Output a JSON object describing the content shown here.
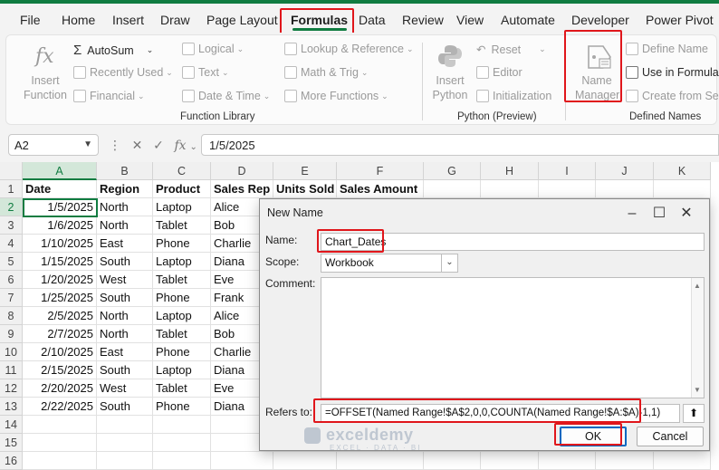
{
  "tabs": [
    "File",
    "Home",
    "Insert",
    "Draw",
    "Page Layout",
    "Formulas",
    "Data",
    "Review",
    "View",
    "Automate",
    "Developer",
    "Power Pivot"
  ],
  "active_tab": "Formulas",
  "ribbon": {
    "insert_function": "Insert Function",
    "autosum": "AutoSum",
    "recently_used": "Recently Used",
    "financial": "Financial",
    "logical": "Logical",
    "text": "Text",
    "date_time": "Date & Time",
    "lookup_reference": "Lookup & Reference",
    "math_trig": "Math & Trig",
    "more_functions": "More Functions",
    "function_library": "Function Library",
    "insert_python": "Insert Python",
    "reset": "Reset",
    "editor": "Editor",
    "initialization": "Initialization",
    "python_preview": "Python (Preview)",
    "name_manager": "Name Manager",
    "define_name": "Define Name",
    "use_in_formula": "Use in Formula",
    "create_from_selection": "Create from Sele",
    "defined_names": "Defined Names"
  },
  "formula_bar": {
    "name_box": "A2",
    "fx": "fx",
    "value": "1/5/2025"
  },
  "columns": [
    "A",
    "B",
    "C",
    "D",
    "E",
    "F",
    "G",
    "H",
    "I",
    "J",
    "K"
  ],
  "rows": [
    "1",
    "2",
    "3",
    "4",
    "5",
    "6",
    "7",
    "8",
    "9",
    "10",
    "11",
    "12",
    "13",
    "14",
    "15",
    "16"
  ],
  "headers": [
    "Date",
    "Region",
    "Product",
    "Sales Rep",
    "Units Sold",
    "Sales Amount"
  ],
  "data": [
    [
      "1/5/2025",
      "North",
      "Laptop",
      "Alice"
    ],
    [
      "1/6/2025",
      "North",
      "Tablet",
      "Bob"
    ],
    [
      "1/10/2025",
      "East",
      "Phone",
      "Charlie"
    ],
    [
      "1/15/2025",
      "South",
      "Laptop",
      "Diana"
    ],
    [
      "1/20/2025",
      "West",
      "Tablet",
      "Eve"
    ],
    [
      "1/25/2025",
      "South",
      "Phone",
      "Frank"
    ],
    [
      "2/5/2025",
      "North",
      "Laptop",
      "Alice"
    ],
    [
      "2/7/2025",
      "North",
      "Tablet",
      "Bob"
    ],
    [
      "2/10/2025",
      "East",
      "Phone",
      "Charlie"
    ],
    [
      "2/15/2025",
      "South",
      "Laptop",
      "Diana"
    ],
    [
      "2/20/2025",
      "West",
      "Tablet",
      "Eve"
    ],
    [
      "2/22/2025",
      "South",
      "Phone",
      "Diana"
    ]
  ],
  "dialog": {
    "title": "New Name",
    "name_label": "Name:",
    "name_value": "Chart_Dates",
    "scope_label": "Scope:",
    "scope_value": "Workbook",
    "comment_label": "Comment:",
    "comment_value": "",
    "refers_label": "Refers to:",
    "refers_value": "=OFFSET(Named Range!$A$2,0,0,COUNTA(Named Range!$A:$A)-1,1)",
    "ok": "OK",
    "cancel": "Cancel",
    "minimize": "–",
    "maximize": "☐",
    "close": "✕"
  },
  "watermark": {
    "brand": "exceldemy",
    "tagline": "EXCEL · DATA · BI"
  },
  "colors": {
    "accent": "#107c41",
    "highlight": "#e0161b",
    "ok_border": "#0067c0"
  }
}
